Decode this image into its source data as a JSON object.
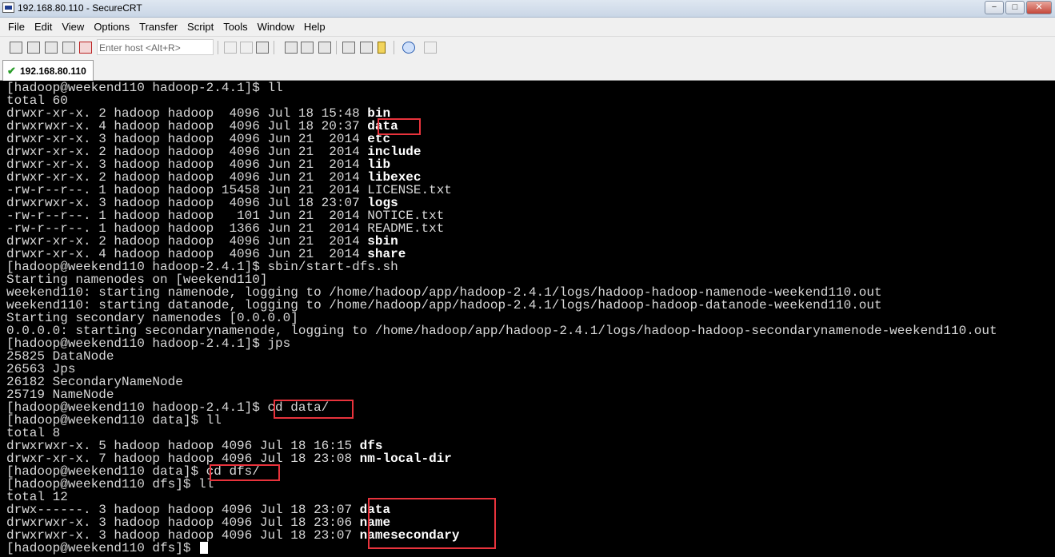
{
  "window": {
    "title": "192.168.80.110 - SecureCRT",
    "buttons": {
      "minimize": "−",
      "maximize": "□",
      "close": "✕"
    }
  },
  "menu": [
    "File",
    "Edit",
    "View",
    "Options",
    "Transfer",
    "Script",
    "Tools",
    "Window",
    "Help"
  ],
  "toolbar": {
    "host_placeholder": "Enter host <Alt+R>",
    "icons": [
      "connect-icon",
      "quick-connect-icon",
      "connect-in-tab-icon",
      "reconnect-icon",
      "disconnect-icon",
      "copy-icon",
      "paste-icon",
      "find-icon",
      "print-setup-icon",
      "print-icon",
      "session-options-icon",
      "global-options-icon",
      "keymap-icon",
      "sftp-icon",
      "help-icon",
      "clone-icon"
    ]
  },
  "tab": {
    "label": "192.168.80.110",
    "status_icon": "check-icon"
  },
  "terminal": {
    "lines": [
      [
        "[hadoop@weekend110 hadoop-2.4.1]$ ll"
      ],
      [
        "total 60"
      ],
      [
        "drwxr-xr-x. 2 hadoop hadoop  4096 Jul 18 15:48 ",
        {
          "b": "bin"
        }
      ],
      [
        "drwxrwxr-x. 4 hadoop hadoop  4096 Jul 18 20:37 ",
        {
          "b": "data"
        }
      ],
      [
        "drwxr-xr-x. 3 hadoop hadoop  4096 Jun 21  2014 ",
        {
          "b": "etc"
        }
      ],
      [
        "drwxr-xr-x. 2 hadoop hadoop  4096 Jun 21  2014 ",
        {
          "b": "include"
        }
      ],
      [
        "drwxr-xr-x. 3 hadoop hadoop  4096 Jun 21  2014 ",
        {
          "b": "lib"
        }
      ],
      [
        "drwxr-xr-x. 2 hadoop hadoop  4096 Jun 21  2014 ",
        {
          "b": "libexec"
        }
      ],
      [
        "-rw-r--r--. 1 hadoop hadoop 15458 Jun 21  2014 LICENSE.txt"
      ],
      [
        "drwxrwxr-x. 3 hadoop hadoop  4096 Jul 18 23:07 ",
        {
          "b": "logs"
        }
      ],
      [
        "-rw-r--r--. 1 hadoop hadoop   101 Jun 21  2014 NOTICE.txt"
      ],
      [
        "-rw-r--r--. 1 hadoop hadoop  1366 Jun 21  2014 README.txt"
      ],
      [
        "drwxr-xr-x. 2 hadoop hadoop  4096 Jun 21  2014 ",
        {
          "b": "sbin"
        }
      ],
      [
        "drwxr-xr-x. 4 hadoop hadoop  4096 Jun 21  2014 ",
        {
          "b": "share"
        }
      ],
      [
        "[hadoop@weekend110 hadoop-2.4.1]$ sbin/start-dfs.sh"
      ],
      [
        "Starting namenodes on [weekend110]"
      ],
      [
        "weekend110: starting namenode, logging to /home/hadoop/app/hadoop-2.4.1/logs/hadoop-hadoop-namenode-weekend110.out"
      ],
      [
        "weekend110: starting datanode, logging to /home/hadoop/app/hadoop-2.4.1/logs/hadoop-hadoop-datanode-weekend110.out"
      ],
      [
        "Starting secondary namenodes [0.0.0.0]"
      ],
      [
        "0.0.0.0: starting secondarynamenode, logging to /home/hadoop/app/hadoop-2.4.1/logs/hadoop-hadoop-secondarynamenode-weekend110.out"
      ],
      [
        "[hadoop@weekend110 hadoop-2.4.1]$ jps"
      ],
      [
        "25825 DataNode"
      ],
      [
        "26563 Jps"
      ],
      [
        "26182 SecondaryNameNode"
      ],
      [
        "25719 NameNode"
      ],
      [
        "[hadoop@weekend110 hadoop-2.4.1]$ cd data/"
      ],
      [
        "[hadoop@weekend110 data]$ ll"
      ],
      [
        "total 8"
      ],
      [
        "drwxrwxr-x. 5 hadoop hadoop 4096 Jul 18 16:15 ",
        {
          "b": "dfs"
        }
      ],
      [
        "drwxr-xr-x. 7 hadoop hadoop 4096 Jul 18 23:08 ",
        {
          "b": "nm-local-dir"
        }
      ],
      [
        "[hadoop@weekend110 data]$ cd dfs/"
      ],
      [
        "[hadoop@weekend110 dfs]$ ll"
      ],
      [
        "total 12"
      ],
      [
        "drwx------. 3 hadoop hadoop 4096 Jul 18 23:07 ",
        {
          "b": "data"
        }
      ],
      [
        "drwxrwxr-x. 3 hadoop hadoop 4096 Jul 18 23:06 ",
        {
          "b": "name"
        }
      ],
      [
        "drwxrwxr-x. 3 hadoop hadoop 4096 Jul 18 23:07 ",
        {
          "b": "namesecondary"
        }
      ],
      [
        "[hadoop@weekend110 dfs]$ ",
        {
          "cursor": true
        }
      ]
    ],
    "highlight_color": "#e8333c"
  }
}
